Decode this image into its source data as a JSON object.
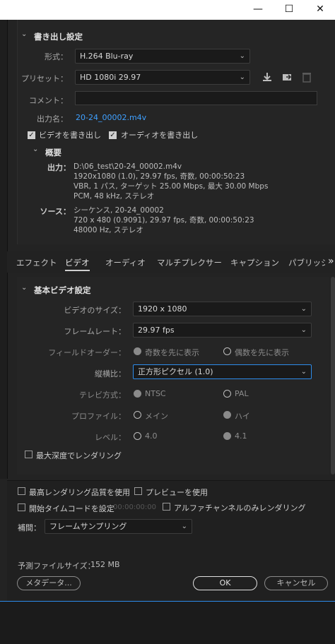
{
  "window": {
    "minimize": "—",
    "maximize": "☐",
    "close": "✕"
  },
  "export_settings": {
    "title": "書き出し設定",
    "format_label": "形式：",
    "format_value": "H.264 Blu-ray",
    "preset_label": "プリセット：",
    "preset_value": "HD 1080i 29.97",
    "comment_label": "コメント：",
    "output_name_label": "出力名：",
    "output_name_value": "20-24_00002.m4v",
    "export_video_label": "ビデオを書き出し",
    "export_audio_label": "オーディオを書き出し"
  },
  "summary": {
    "title": "概要",
    "output_label": "出力：",
    "output_lines": [
      "D:\\06_test\\20-24_00002.m4v",
      "1920x1080 (1.0), 29.97 fps, 奇数, 00:00:50:23",
      "VBR, 1 パス, ターゲット 25.00 Mbps, 最大 30.00 Mbps",
      "PCM, 48 kHz, ステレオ"
    ],
    "source_label": "ソース：",
    "source_lines": [
      "シーケンス, 20-24_00002",
      "720 x 480 (0.9091), 29.97 fps, 奇数, 00:00:50:23",
      "48000 Hz, ステレオ"
    ]
  },
  "tabs": [
    "エフェクト",
    "ビデオ",
    "オーディオ",
    "マルチプレクサー",
    "キャプション",
    "パブリッシュ"
  ],
  "tabs_more": "»",
  "basic_video": {
    "title": "基本ビデオ設定",
    "size_label": "ビデオのサイズ：",
    "size_value": "1920 x 1080",
    "framerate_label": "フレームレート：",
    "framerate_value": "29.97 fps",
    "field_order_label": "フィールドオーダー：",
    "field_order_opt1": "奇数を先に表示",
    "field_order_opt2": "偶数を先に表示",
    "aspect_label": "縦横比：",
    "aspect_value": "正方形ピクセル (1.0)",
    "tv_label": "テレビ方式：",
    "tv_opt1": "NTSC",
    "tv_opt2": "PAL",
    "profile_label": "プロファイル：",
    "profile_opt1": "メイン",
    "profile_opt2": "ハイ",
    "level_label": "レベル：",
    "level_opt1": "4.0",
    "level_opt2": "4.1",
    "max_depth_label": "最大深度でレンダリング"
  },
  "bottom": {
    "max_quality_label": "最高レンダリング品質を使用",
    "use_preview_label": "プレビューを使用",
    "start_tc_label": "開始タイムコードを設定",
    "start_tc_value": "00:00:00:00",
    "alpha_only_label": "アルファチャンネルのみレンダリング",
    "interp_label": "補間：",
    "interp_value": "フレームサンプリング",
    "file_size_label": "予測ファイルサイズ：",
    "file_size_value": "152 MB",
    "metadata_button": "メタデータ...",
    "ok_button": "OK",
    "cancel_button": "キャンセル"
  },
  "colors": {
    "accent": "#2d8ceb",
    "link": "#3fa0ff"
  }
}
